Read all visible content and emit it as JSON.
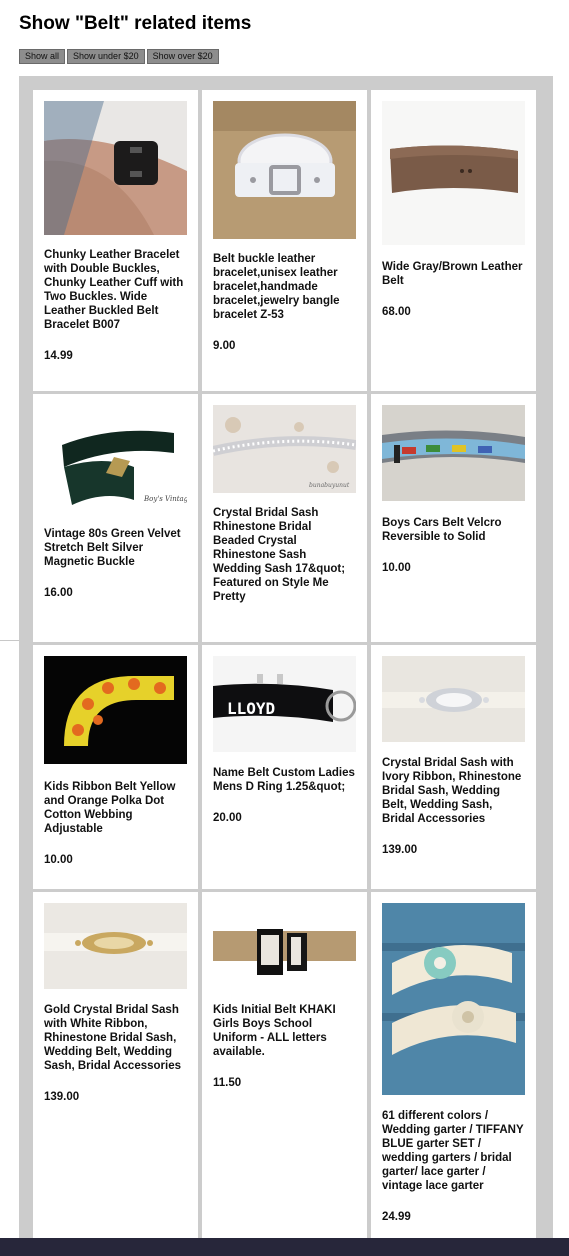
{
  "page": {
    "title": "Show \"Belt\" related items"
  },
  "filters": [
    {
      "label": "Show all"
    },
    {
      "label": "Show under $20"
    },
    {
      "label": "Show over $20"
    }
  ],
  "products": [
    {
      "title": "Chunky Leather Bracelet with Double Buckles, Chunky Leather Cuff with Two Buckles. Wide Leather Buckled Belt Bracelet B007",
      "price": "14.99",
      "image": "leather-cuff-bracelet-photo"
    },
    {
      "title": "Belt buckle leather bracelet,unisex leather bracelet,handmade bracelet,jewelry bangle bracelet Z-53",
      "price": "9.00",
      "image": "white-buckle-bracelet-photo"
    },
    {
      "title": "Wide Gray/Brown Leather Belt",
      "price": "68.00",
      "image": "brown-leather-belt-photo"
    },
    {
      "title": "Vintage 80s Green Velvet Stretch Belt Silver Magnetic Buckle",
      "price": "16.00",
      "image": "green-velvet-belt-photo",
      "watermark": "Boy's Vintage"
    },
    {
      "title": "Crystal Bridal Sash Rhinestone Bridal Beaded Crystal Rhinestone Sash Wedding Sash 17&quot; Featured on Style Me Pretty",
      "price": "",
      "image": "rhinestone-sash-photo",
      "watermark": "bunabuyunut"
    },
    {
      "title": "Boys Cars Belt Velcro Reversible to Solid",
      "price": "10.00",
      "image": "cars-belt-photo"
    },
    {
      "title": "Kids Ribbon Belt Yellow and Orange Polka Dot Cotton Webbing Adjustable",
      "price": "10.00",
      "image": "polka-dot-belt-photo"
    },
    {
      "title": "Name Belt Custom Ladies Mens D Ring 1.25&quot;",
      "price": "20.00",
      "image": "name-belt-photo",
      "name_on_belt": "LLOYD"
    },
    {
      "title": "Crystal Bridal Sash with Ivory Ribbon, Rhinestone Bridal Sash, Wedding Belt, Wedding Sash, Bridal Accessories",
      "price": "139.00",
      "image": "ivory-crystal-sash-photo"
    },
    {
      "title": "Gold Crystal Bridal Sash with White Ribbon, Rhinestone Bridal Sash, Wedding Belt, Wedding Sash, Bridal Accessories",
      "price": "139.00",
      "image": "gold-crystal-sash-photo"
    },
    {
      "title": "Kids Initial Belt KHAKI Girls Boys School Uniform - ALL letters available.",
      "price": "11.50",
      "image": "khaki-initial-belt-photo"
    },
    {
      "title": "61 different colors / Wedding garter / TIFFANY BLUE garter SET / wedding garters / bridal garter/ lace garter / vintage lace garter",
      "price": "24.99",
      "image": "tiffany-garter-photo"
    }
  ],
  "colors": {
    "grid_background": "#cccccc",
    "button_background": "#8d8d8d",
    "footer_bar": "#27263a"
  }
}
